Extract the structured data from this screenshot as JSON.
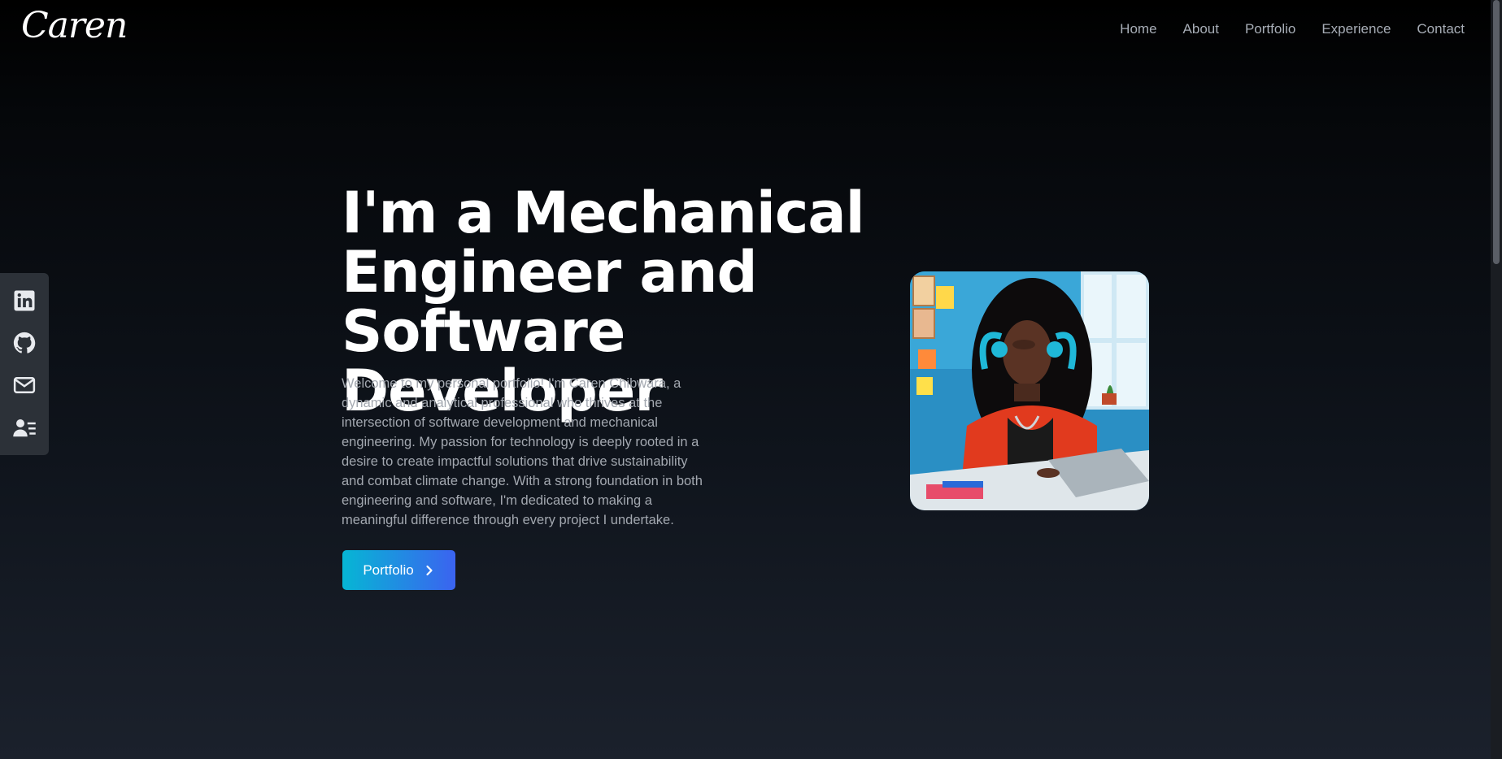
{
  "header": {
    "logo": "Caren",
    "nav": [
      "Home",
      "About",
      "Portfolio",
      "Experience",
      "Contact"
    ]
  },
  "social": [
    "linkedin-icon",
    "github-icon",
    "mail-icon",
    "resume-icon"
  ],
  "hero": {
    "title_line1": "I'm a Mechanical",
    "title_line2": "Engineer and",
    "title_line3": "Software Developer",
    "description": "Welcome to my personal portfolio! I'm Caren Chibwara, a dynamic and analytical professional who thrives at the intersection of software development and mechanical engineering. My passion for technology is deeply rooted in a desire to create impactful solutions that drive sustainability and combat climate change. With a strong foundation in both engineering and software, I'm dedicated to making a meaningful difference through every project I undertake.",
    "button_label": "Portfolio",
    "button_icon": "chevron-right-icon"
  },
  "colors": {
    "accent_start": "#06b6d4",
    "accent_end": "#3b63f0",
    "nav_text": "#a7adb6",
    "body_text": "#a3a8b0",
    "sidebar_bg": "#2c3138"
  }
}
